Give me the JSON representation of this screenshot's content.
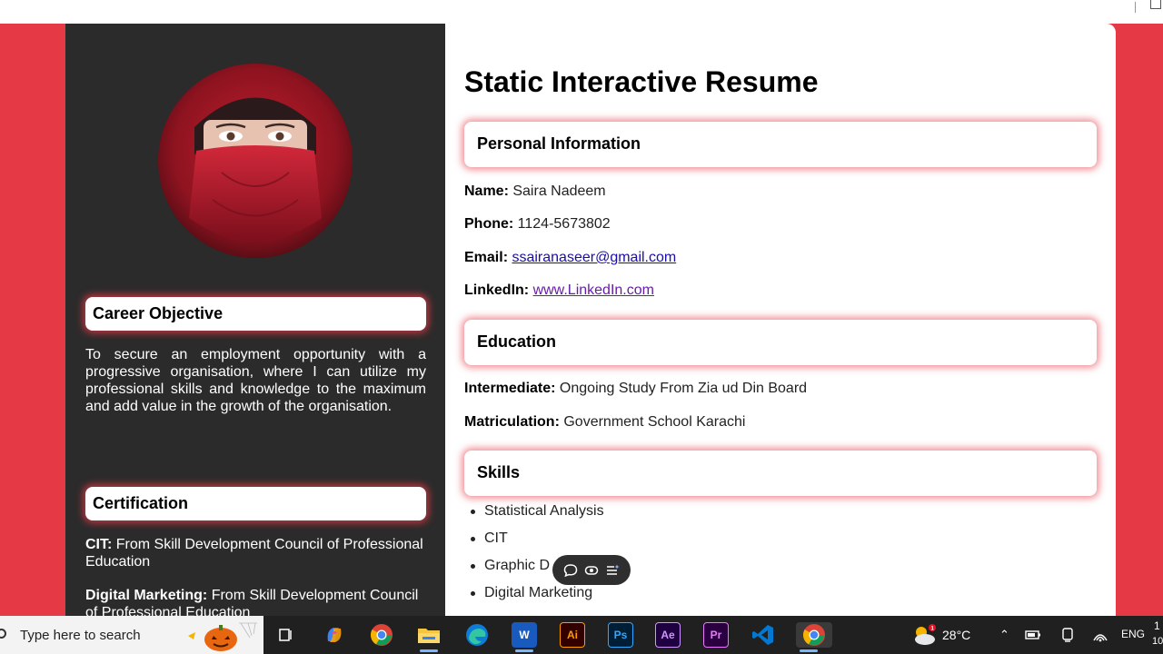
{
  "resume": {
    "title": "Static Interactive Resume",
    "career_objective": {
      "heading": "Career Objective",
      "text": "To secure an employment opportunity with a progressive organisation, where I can utilize my professional skills and knowledge to the maximum and add value in the growth of the organisation."
    },
    "certification": {
      "heading": "Certification",
      "items": [
        {
          "label": "CIT:",
          "value": "From Skill Development Council of Professional Education"
        },
        {
          "label": "Digital Marketing:",
          "value": "From Skill Development Council of Professional Education"
        }
      ]
    },
    "personal_information": {
      "heading": "Personal Information",
      "name_label": "Name:",
      "name": "Saira Nadeem",
      "phone_label": "Phone:",
      "phone": "1124-5673802",
      "email_label": "Email:",
      "email": "ssairanaseer@gmail.com",
      "linkedin_label": "LinkedIn:",
      "linkedin": "www.LinkedIn.com"
    },
    "education": {
      "heading": "Education",
      "items": [
        {
          "label": "Intermediate:",
          "value": "Ongoing Study From Zia ud Din Board"
        },
        {
          "label": "Matriculation:",
          "value": "Government School Karachi"
        }
      ]
    },
    "skills": {
      "heading": "Skills",
      "items": [
        "Statistical Analysis",
        "CIT",
        "Graphic D",
        "Digital Marketing"
      ]
    }
  },
  "taskbar": {
    "search_placeholder": "Type here to search",
    "apps": [
      "task-view",
      "copilot",
      "chrome",
      "file-explorer",
      "edge",
      "word",
      "illustrator",
      "photoshop",
      "after-effects",
      "premiere",
      "vscode",
      "chrome-active"
    ],
    "weather": "28°C",
    "language": "ENG",
    "clock_partial": "1",
    "clock_partial2": "10"
  },
  "colors": {
    "page_background": "#e63946",
    "sidebar_background": "#2b2b2b",
    "link": "#1a0dab",
    "visited_link": "#681da8"
  }
}
